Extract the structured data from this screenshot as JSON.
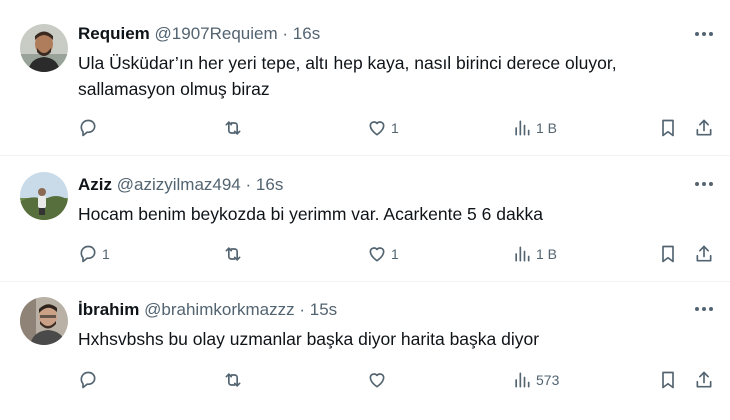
{
  "colors": {
    "text": "#0f1419",
    "secondary": "#536471",
    "divider": "#eff3f4"
  },
  "replies": [
    {
      "name": "Requiem",
      "handle": "@1907Requiem",
      "dot": "·",
      "time": "16s",
      "text_lines": [
        "Ula Üsküdar’ın her yeri tepe, altı hep kaya, nasıl birinci derece oluyor,",
        "sallamasyon olmuş biraz"
      ],
      "reply_count": "",
      "retweet_count": "",
      "like_count": "1",
      "view_count": "1 B",
      "icons": [
        "reply-icon",
        "retweet-icon",
        "like-icon",
        "views-icon",
        "bookmark-icon",
        "share-icon",
        "more-icon"
      ]
    },
    {
      "name": "Aziz",
      "handle": "@azizyilmaz494",
      "dot": "·",
      "time": "16s",
      "text_lines": [
        "Hocam benim beykozda bi yerimm var. Acarkente 5 6 dakka"
      ],
      "reply_count": "1",
      "retweet_count": "",
      "like_count": "1",
      "view_count": "1 B",
      "icons": [
        "reply-icon",
        "retweet-icon",
        "like-icon",
        "views-icon",
        "bookmark-icon",
        "share-icon",
        "more-icon"
      ]
    },
    {
      "name": "İbrahim",
      "handle": "@brahimkorkmazzz",
      "dot": "·",
      "time": "15s",
      "text_lines": [
        "Hxhsvbshs bu olay uzmanlar başka diyor harita başka diyor"
      ],
      "reply_count": "",
      "retweet_count": "",
      "like_count": "",
      "view_count": "573",
      "icons": [
        "reply-icon",
        "retweet-icon",
        "like-icon",
        "views-icon",
        "bookmark-icon",
        "share-icon",
        "more-icon"
      ]
    }
  ]
}
